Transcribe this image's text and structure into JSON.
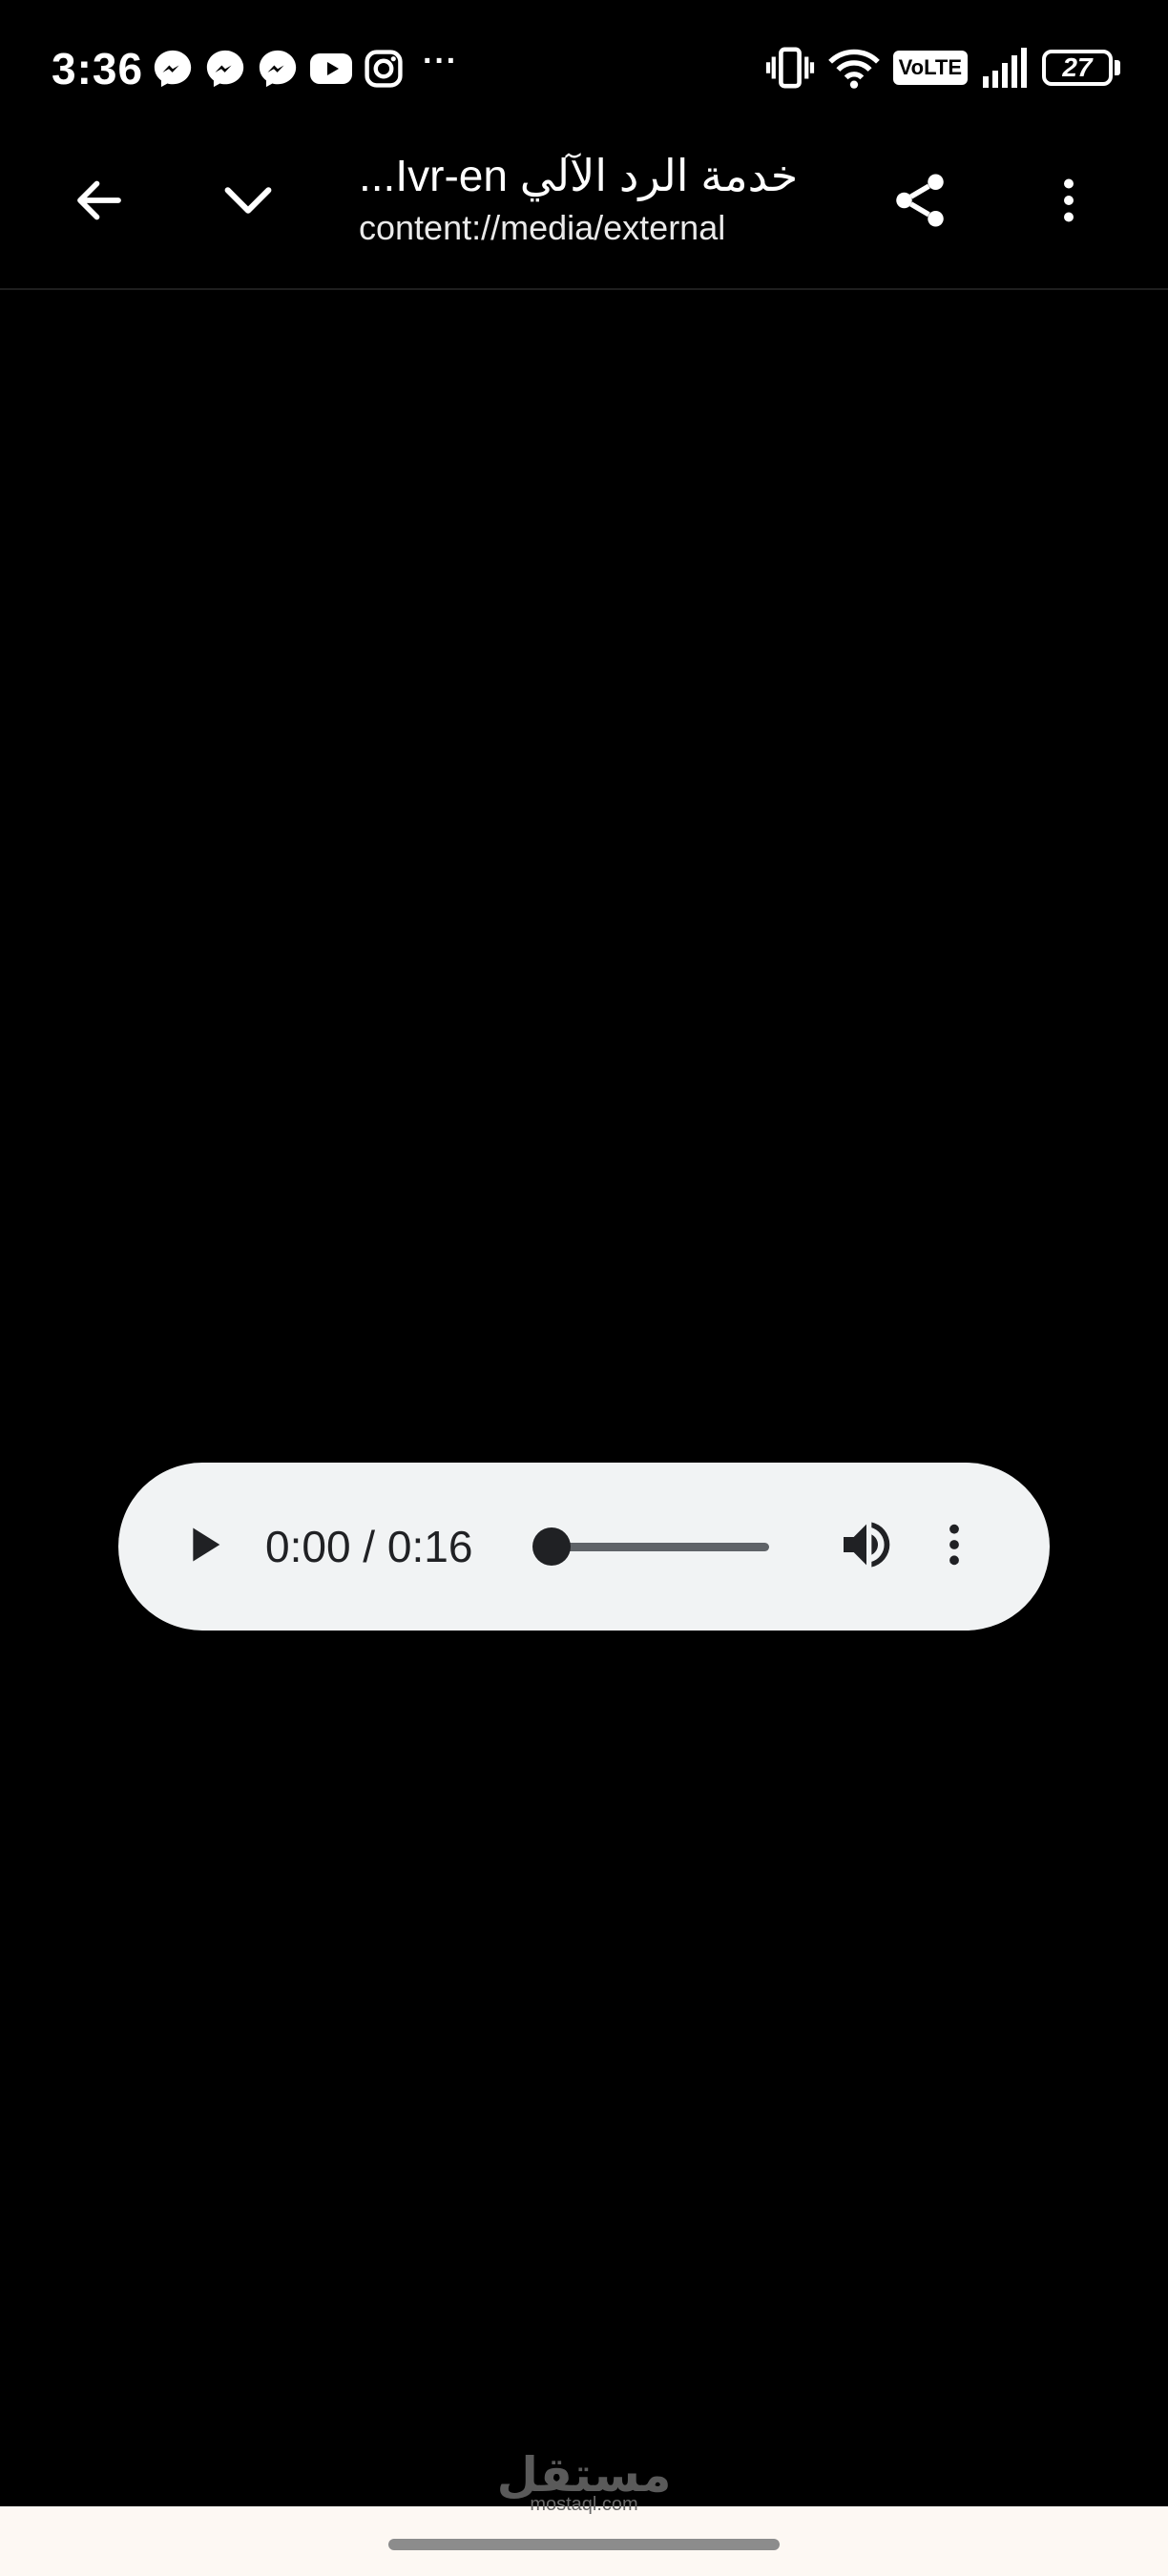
{
  "status_bar": {
    "time": "3:36",
    "overflow_indicator": "···",
    "notification_icons": [
      "messenger-icon",
      "messenger-icon",
      "messenger-icon",
      "youtube-icon",
      "instagram-icon"
    ],
    "network_badge": "VoLTE",
    "battery_percent": "27"
  },
  "app_bar": {
    "title": "خدمة الرد الآلي Ivr-en...",
    "subtitle": "content://media/external",
    "icons": {
      "back": "arrow-back-icon",
      "collapse": "chevron-down-icon",
      "share": "share-icon",
      "overflow": "more-vertical-icon"
    }
  },
  "audio_player": {
    "time_display": "0:00 / 0:16",
    "current_time": "0:00",
    "duration": "0:16",
    "progress": 0,
    "icons": {
      "play": "play-icon",
      "volume": "volume-icon",
      "menu": "more-vertical-icon"
    },
    "background_color": "#f1f3f4"
  },
  "watermark": {
    "arabic": "مستقل",
    "latin": "mostaql.com"
  },
  "colors": {
    "background": "#000000",
    "foreground": "#ffffff",
    "nav_bar": "#fdf8f3"
  }
}
